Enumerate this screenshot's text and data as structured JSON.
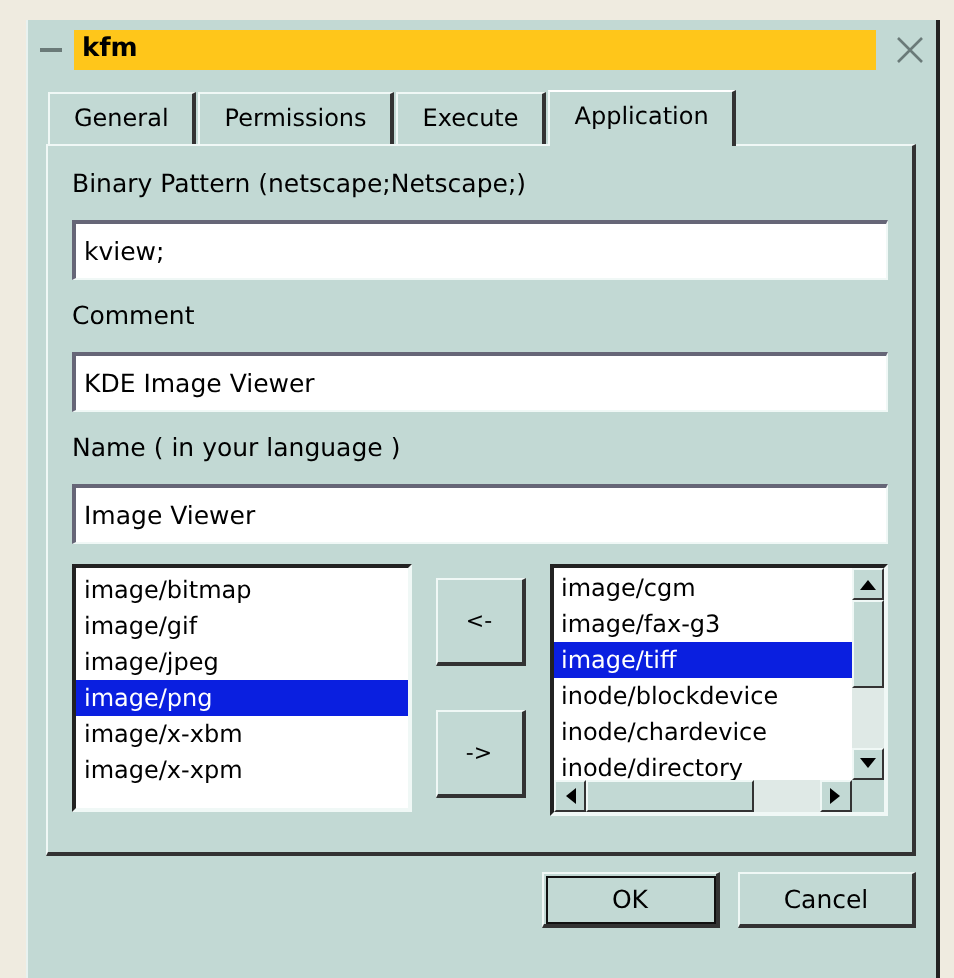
{
  "window": {
    "title": "kfm"
  },
  "tabs": [
    {
      "label": "General",
      "selected": false
    },
    {
      "label": "Permissions",
      "selected": false
    },
    {
      "label": "Execute",
      "selected": false
    },
    {
      "label": "Application",
      "selected": true
    }
  ],
  "fields": [
    {
      "label": "Binary Pattern (netscape;Netscape;)",
      "value": "kview;"
    },
    {
      "label": "Comment",
      "value": "KDE Image Viewer"
    },
    {
      "label": "Name ( in your language )",
      "value": "Image Viewer"
    }
  ],
  "selected_types": [
    {
      "label": "image/bitmap",
      "selected": false
    },
    {
      "label": "image/gif",
      "selected": false
    },
    {
      "label": "image/jpeg",
      "selected": false
    },
    {
      "label": "image/png",
      "selected": true
    },
    {
      "label": "image/x-xbm",
      "selected": false
    },
    {
      "label": "image/x-xpm",
      "selected": false
    }
  ],
  "move_buttons": [
    "<-",
    "->"
  ],
  "available_types": [
    {
      "label": "image/cgm",
      "selected": false
    },
    {
      "label": "image/fax-g3",
      "selected": false
    },
    {
      "label": "image/tiff",
      "selected": true
    },
    {
      "label": "inode/blockdevice",
      "selected": false
    },
    {
      "label": "inode/chardevice",
      "selected": false
    },
    {
      "label": "inode/directory",
      "selected": false
    }
  ],
  "buttons": [
    "OK",
    "Cancel"
  ]
}
